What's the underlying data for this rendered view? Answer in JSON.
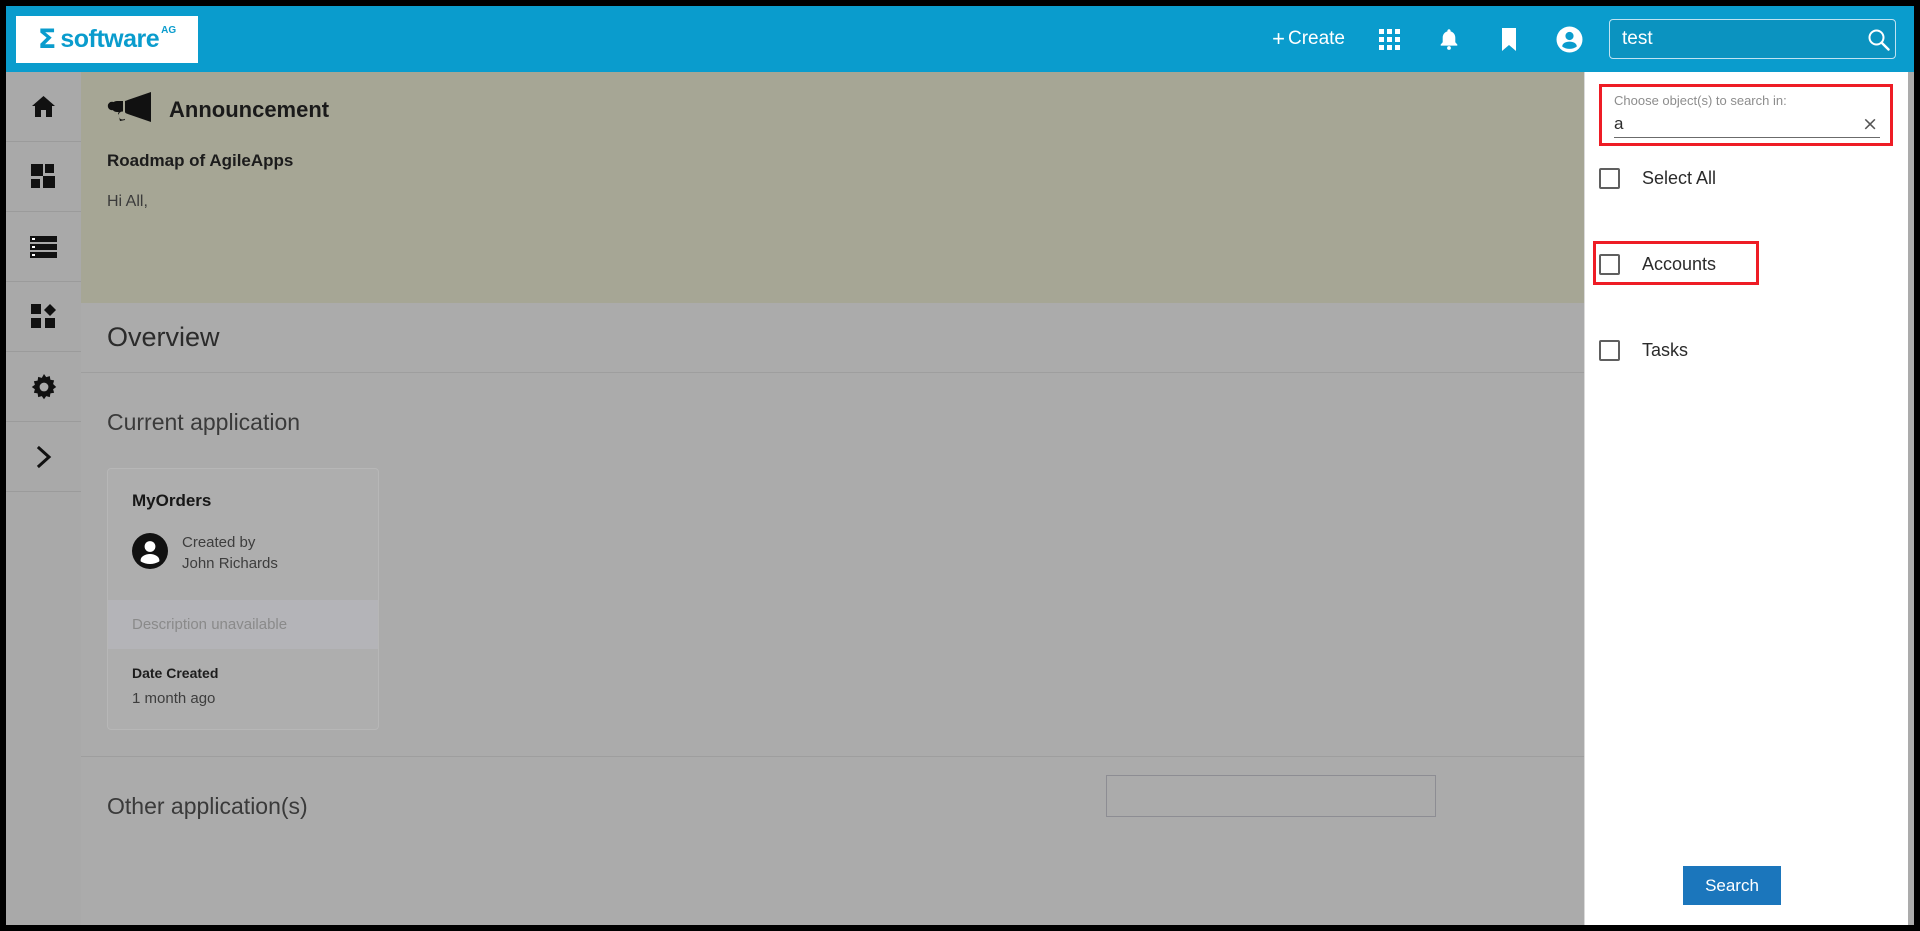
{
  "app": {
    "brand_mark": "Ʃ",
    "brand_word": "software",
    "brand_sup": "AG",
    "accent_color": "#0a9ccd",
    "highlight_color": "#ee1c25",
    "button_color": "#1b76bc"
  },
  "topbar": {
    "create_plus": "+",
    "create_label": "Create",
    "icons": [
      {
        "name": "apps-grid-icon",
        "title": "Apps"
      },
      {
        "name": "bell-icon",
        "title": "Notifications"
      },
      {
        "name": "bookmark-icon",
        "title": "Bookmarks"
      },
      {
        "name": "account-icon",
        "title": "Account"
      }
    ],
    "search": {
      "value": "test",
      "placeholder": "Search",
      "icon": "search-icon"
    }
  },
  "sidebar": {
    "items": [
      {
        "name": "home-icon",
        "label": "Home"
      },
      {
        "name": "dashboard-icon",
        "label": "Dashboard"
      },
      {
        "name": "list-icon",
        "label": "Records"
      },
      {
        "name": "apps-icon",
        "label": "Applications"
      },
      {
        "name": "gear-icon",
        "label": "Settings"
      },
      {
        "name": "chevron-right-icon",
        "label": "Expand"
      }
    ]
  },
  "announcement": {
    "icon": "megaphone-icon",
    "title": "Announcement",
    "subject": "Roadmap of AgileApps",
    "body": "Hi All,"
  },
  "overview": {
    "title": "Overview",
    "current_application": {
      "section_title": "Current application",
      "card": {
        "name": "MyOrders",
        "avatar_icon": "user-avatar-icon",
        "created_by_label": "Created by",
        "created_by_name": "John Richards",
        "description": "Description unavailable",
        "date_created_label": "Date Created",
        "date_created_value": "1 month ago"
      }
    },
    "other_applications": {
      "section_title": "Other application(s)",
      "filter_input_value": "",
      "filter_input_placeholder": ""
    }
  },
  "object_panel": {
    "field_label": "Choose object(s) to search in:",
    "field_value": "a",
    "field_placeholder": "",
    "clear_icon": "×",
    "options": [
      {
        "label": "Select All",
        "checked": false
      },
      {
        "label": "Accounts",
        "checked": false
      },
      {
        "label": "Tasks",
        "checked": false
      }
    ],
    "search_button_label": "Search"
  }
}
